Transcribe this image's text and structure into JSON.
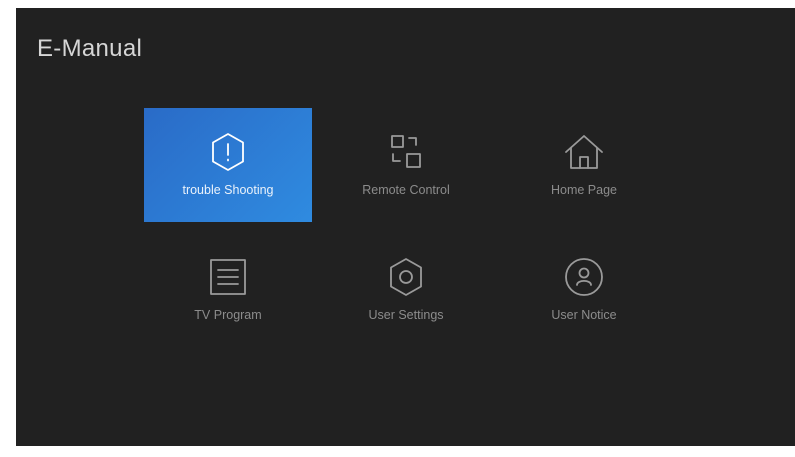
{
  "app": {
    "title": "E-Manual"
  },
  "menu": {
    "items": [
      {
        "label": "trouble Shooting",
        "icon": "warning-hexagon-icon",
        "focused": true
      },
      {
        "label": "Remote Control",
        "icon": "remote-squares-icon",
        "focused": false
      },
      {
        "label": "Home Page",
        "icon": "home-icon",
        "focused": false
      },
      {
        "label": "TV Program",
        "icon": "list-document-icon",
        "focused": false
      },
      {
        "label": "User Settings",
        "icon": "settings-hexagon-icon",
        "focused": false
      },
      {
        "label": "User Notice",
        "icon": "user-circle-icon",
        "focused": false
      }
    ]
  },
  "colors": {
    "background": "#212121",
    "focus_accent": "#2f8be0",
    "label_idle": "#8c8c8c"
  }
}
